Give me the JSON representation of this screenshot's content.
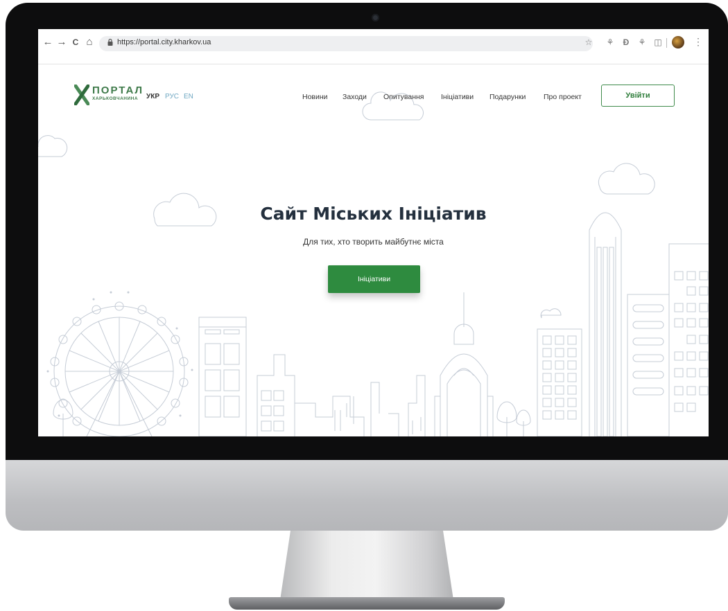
{
  "browser": {
    "back": "←",
    "forward": "→",
    "reload": "C",
    "home": "⌂",
    "url": "https://portal.city.kharkov.ua",
    "star": "☆",
    "extensions": [
      "⚘",
      "Ð",
      "⚘",
      "◫"
    ],
    "menu": "⋮"
  },
  "site": {
    "logo_title": "ПОРТАЛ",
    "logo_subtitle": "ХАРЬКОВЧАНИНА",
    "languages": [
      "УКР",
      "РУС",
      "EN"
    ],
    "nav": [
      "Новини",
      "Заходи",
      "Опитування",
      "Ініціативи",
      "Подарунки",
      "Про проект"
    ],
    "login_label": "Увійти"
  },
  "hero": {
    "title": "Сайт Міських Ініціатив",
    "subtitle": "Для тих, хто творить майбутнє міста",
    "button_label": "Ініціативи"
  },
  "colors": {
    "brand_green": "#2e8b3f",
    "logo_green": "#3e7a4a",
    "lang_inactive": "#6fa7c2",
    "illustration_line": "#c5ccd6"
  }
}
